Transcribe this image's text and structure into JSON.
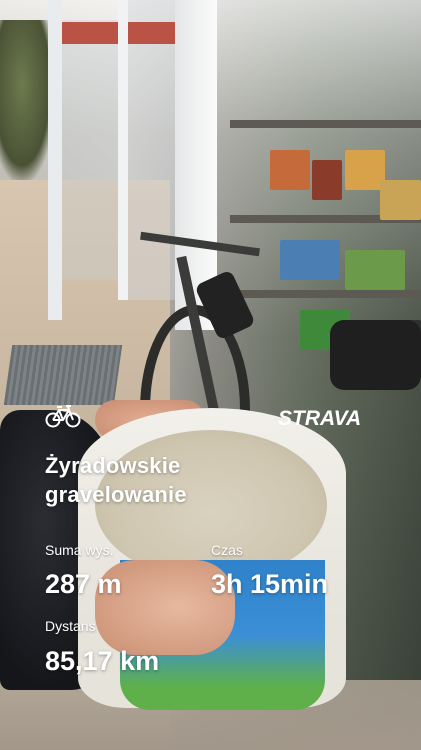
{
  "activity": {
    "icon": "bicycle-icon",
    "title_line1": "Żyradowskie",
    "title_line2": "gravelowanie"
  },
  "brand": {
    "logo_text": "STRAVA",
    "logo_icon": "strava-wordmark"
  },
  "stats": {
    "elevation": {
      "label": "Suma wys.",
      "value": "287 m"
    },
    "time": {
      "label": "Czas",
      "value": "3h 15min"
    },
    "distance": {
      "label": "Dystans",
      "value": "85,17 km"
    }
  },
  "colors": {
    "overlay_text": "#ffffff"
  }
}
